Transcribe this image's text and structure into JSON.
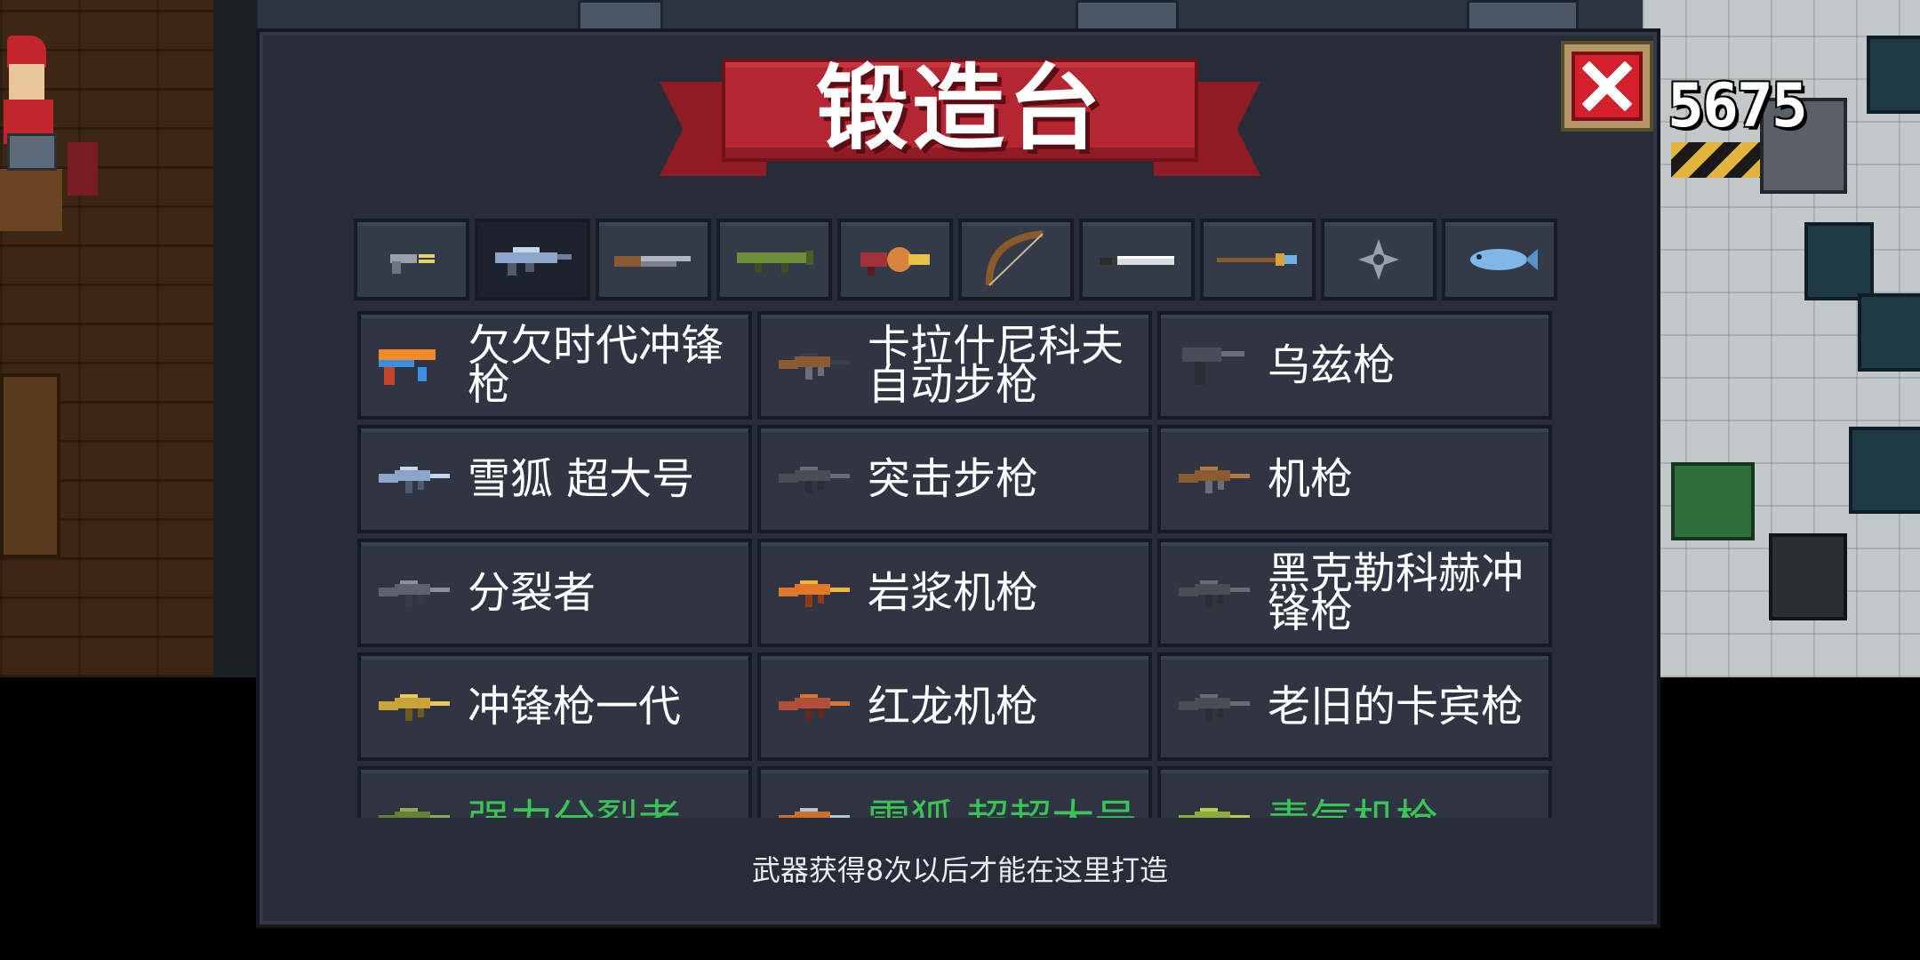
{
  "window": {
    "title": "锻造台",
    "coins": "5675",
    "close_icon": "close-icon"
  },
  "colors": {
    "banner": "#b42631",
    "panel": "#272c38",
    "cell": "#2f3542",
    "locked_text": "#3fd45b",
    "close": "#d4202a"
  },
  "tabs": [
    {
      "icon": "pistol-icon",
      "active": false
    },
    {
      "icon": "smg-rifle-icon",
      "active": true
    },
    {
      "icon": "shotgun-icon",
      "active": false
    },
    {
      "icon": "rocket-launcher-icon",
      "active": false
    },
    {
      "icon": "grenade-launcher-icon",
      "active": false
    },
    {
      "icon": "bow-icon",
      "active": false
    },
    {
      "icon": "sword-icon",
      "active": false
    },
    {
      "icon": "staff-icon",
      "active": false
    },
    {
      "icon": "shuriken-icon",
      "active": false
    },
    {
      "icon": "fish-icon",
      "active": false
    }
  ],
  "weapons": [
    {
      "name": "欠欠时代冲锋枪",
      "icon": "orange-blue-smg-icon",
      "locked": false
    },
    {
      "name": "卡拉什尼科夫自动步枪",
      "icon": "ak-rifle-icon",
      "locked": false
    },
    {
      "name": "乌兹枪",
      "icon": "uzi-icon",
      "locked": false
    },
    {
      "name": "雪狐  超大号",
      "icon": "snow-fox-rifle-icon",
      "locked": false
    },
    {
      "name": "突击步枪",
      "icon": "assault-rifle-icon",
      "locked": false
    },
    {
      "name": "机枪",
      "icon": "machine-gun-icon",
      "locked": false
    },
    {
      "name": "分裂者",
      "icon": "splitter-gun-icon",
      "locked": false
    },
    {
      "name": "岩浆机枪",
      "icon": "magma-gun-icon",
      "locked": false
    },
    {
      "name": "黑克勒科赫冲锋枪",
      "icon": "hk-smg-icon",
      "locked": false
    },
    {
      "name": "冲锋枪一代",
      "icon": "gold-smg-icon",
      "locked": false
    },
    {
      "name": "红龙机枪",
      "icon": "red-dragon-gun-icon",
      "locked": false
    },
    {
      "name": "老旧的卡宾枪",
      "icon": "old-carbine-icon",
      "locked": false
    },
    {
      "name": "强力分裂者",
      "icon": "power-splitter-icon",
      "locked": true
    },
    {
      "name": "雪狐  超超大号",
      "icon": "snow-fox-xl-icon",
      "locked": true
    },
    {
      "name": "毒气机枪",
      "icon": "poison-gun-icon",
      "locked": true
    }
  ],
  "hint": "武器获得8次以后才能在这里打造"
}
